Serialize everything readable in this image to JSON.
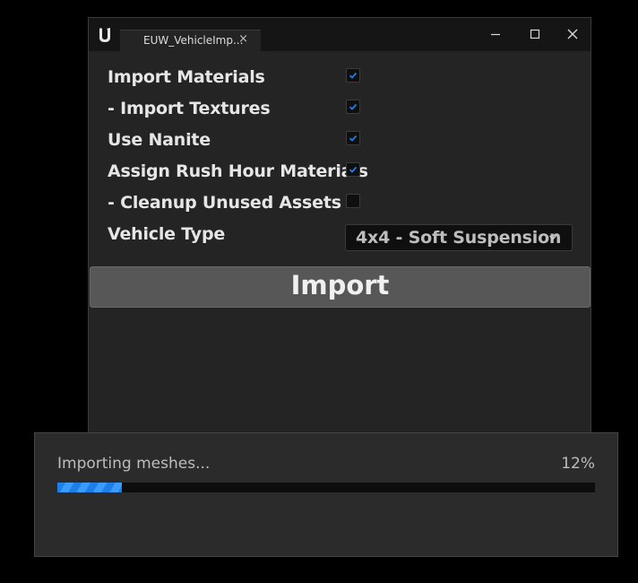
{
  "window": {
    "tab_title": "EUW_VehicleImp...",
    "tab_close_glyph": "×",
    "accent_color": "#1f7fe8"
  },
  "options": [
    {
      "label": "Import Materials",
      "checked": true
    },
    {
      "label": "- Import Textures",
      "checked": true
    },
    {
      "label": "Use Nanite",
      "checked": true
    },
    {
      "label": "Assign Rush Hour Materials",
      "checked": true
    },
    {
      "label": "- Cleanup Unused Assets !",
      "checked": false
    }
  ],
  "vehicle_type": {
    "label": "Vehicle Type",
    "selected": "4x4 - Soft Suspension"
  },
  "import_button": {
    "label": "Import"
  },
  "progress": {
    "status": "Importing meshes...",
    "percent_text": "12%",
    "fraction": 0.12
  },
  "icons": {
    "logo": "unreal-logo-icon",
    "minimize": "minimize-icon",
    "maximize": "maximize-icon",
    "close": "close-icon",
    "check": "checkmark-icon",
    "dropdown": "chevron-down-icon"
  }
}
